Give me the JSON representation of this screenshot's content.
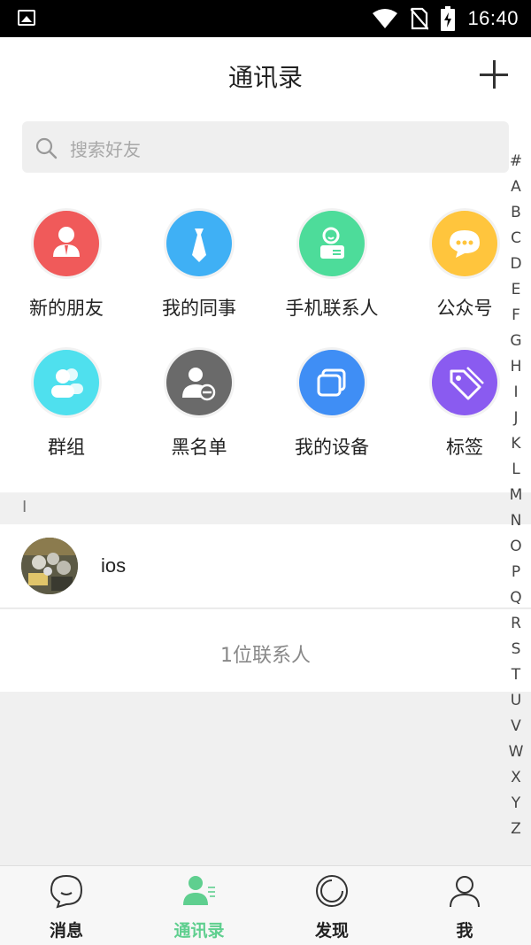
{
  "status_bar": {
    "time": "16:40"
  },
  "header": {
    "title": "通讯录"
  },
  "search": {
    "placeholder": "搜索好友"
  },
  "shortcuts": [
    {
      "label": "新的朋友",
      "icon": "new-friend-icon",
      "color": "#f05a5a"
    },
    {
      "label": "我的同事",
      "icon": "colleague-tie-icon",
      "color": "#3fb0f5"
    },
    {
      "label": "手机联系人",
      "icon": "phone-contact-icon",
      "color": "#4ddc9a"
    },
    {
      "label": "公众号",
      "icon": "official-account-chat-icon",
      "color": "#ffc53d"
    },
    {
      "label": "群组",
      "icon": "group-icon",
      "color": "#4fe0ee"
    },
    {
      "label": "黑名单",
      "icon": "blacklist-icon",
      "color": "#6a6a6a"
    },
    {
      "label": "我的设备",
      "icon": "device-icon",
      "color": "#3f8ef5"
    },
    {
      "label": "标签",
      "icon": "tag-icon",
      "color": "#8a5bf0"
    }
  ],
  "alphabet": [
    "#",
    "A",
    "B",
    "C",
    "D",
    "E",
    "F",
    "G",
    "H",
    "I",
    "J",
    "K",
    "L",
    "M",
    "N",
    "O",
    "P",
    "Q",
    "R",
    "S",
    "T",
    "U",
    "V",
    "W",
    "X",
    "Y",
    "Z"
  ],
  "section_header": "I",
  "contacts": [
    {
      "name": "ios"
    }
  ],
  "contact_count": "1位联系人",
  "tabs": [
    {
      "label": "消息",
      "icon": "message-bubble-icon",
      "active": false
    },
    {
      "label": "通讯录",
      "icon": "contacts-icon",
      "active": true
    },
    {
      "label": "发现",
      "icon": "discover-icon",
      "active": false
    },
    {
      "label": "我",
      "icon": "profile-icon",
      "active": false
    }
  ],
  "accent_color": "#5fcf8f"
}
